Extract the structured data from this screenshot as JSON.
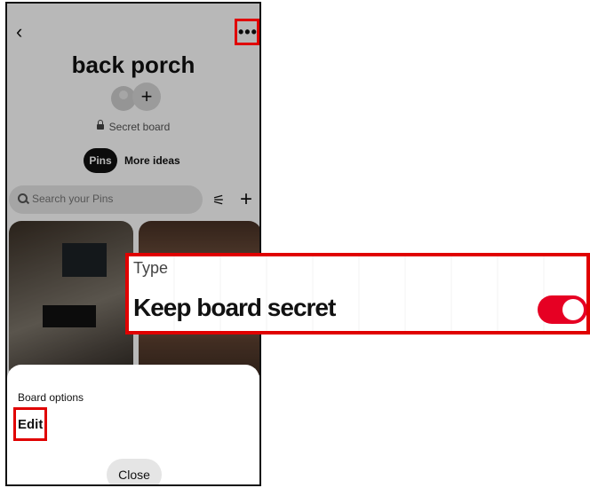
{
  "board": {
    "title": "back porch",
    "privacy": "Secret board",
    "more_glyph": "•••",
    "back_glyph": "‹"
  },
  "tabs": [
    {
      "label": "Pins",
      "active": true
    },
    {
      "label": "More ideas",
      "active": false
    }
  ],
  "search": {
    "placeholder": "Search your Pins"
  },
  "sheet": {
    "heading": "Board options",
    "edit_label": "Edit",
    "close_label": "Close"
  },
  "callout": {
    "type_label": "Type",
    "setting_label": "Keep board secret",
    "toggle_on": true
  },
  "colors": {
    "toggle_on": "#e60023",
    "highlight": "#e00000"
  },
  "icons": [
    "back-icon",
    "more-icon",
    "lock-icon",
    "avatar-icon",
    "add-collaborator-icon",
    "search-icon",
    "filter-icon",
    "plus-icon"
  ]
}
